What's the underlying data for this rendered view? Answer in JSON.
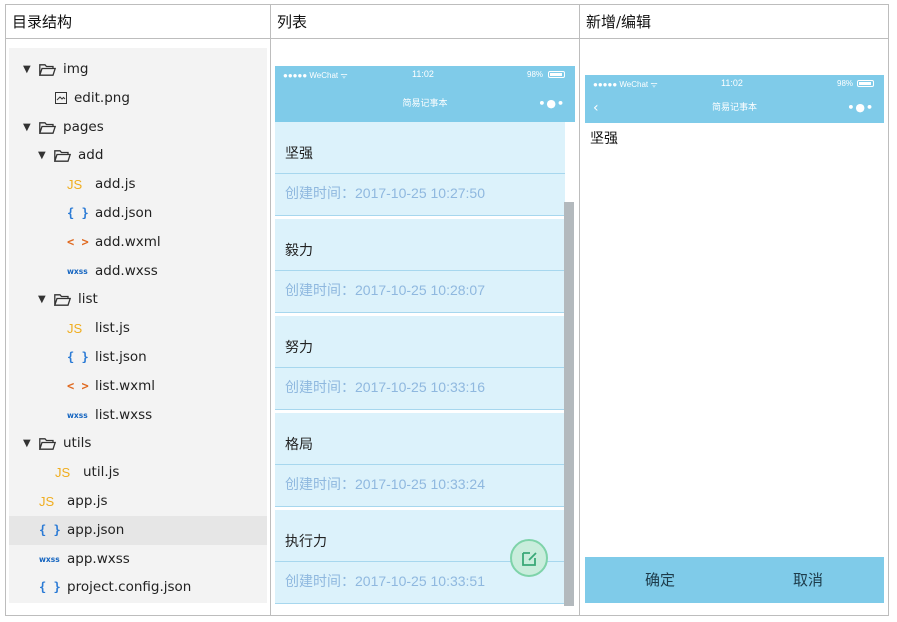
{
  "headers": {
    "col1": "目录结构",
    "col2": "列表",
    "col3": "新增/编辑"
  },
  "colors": {
    "nav": "#7fcbe9",
    "row": "#dcf2fb",
    "time": "#8fb8df",
    "accent_green": "#7ed3a9"
  },
  "tree": [
    {
      "label": "img",
      "type": "folder",
      "icon": "folder-icon"
    },
    {
      "label": "edit.png",
      "type": "image",
      "icon": "image-file-icon"
    },
    {
      "label": "pages",
      "type": "folder",
      "icon": "folder-icon"
    },
    {
      "label": "add",
      "type": "folder",
      "icon": "folder-icon"
    },
    {
      "label": "add.js",
      "type": "js",
      "badge": "JS"
    },
    {
      "label": "add.json",
      "type": "json",
      "badge": "{ }"
    },
    {
      "label": "add.wxml",
      "type": "wxml",
      "badge": "< >"
    },
    {
      "label": "add.wxss",
      "type": "wxss",
      "badge": "wxss"
    },
    {
      "label": "list",
      "type": "folder",
      "icon": "folder-icon"
    },
    {
      "label": "list.js",
      "type": "js",
      "badge": "JS"
    },
    {
      "label": "list.json",
      "type": "json",
      "badge": "{ }"
    },
    {
      "label": "list.wxml",
      "type": "wxml",
      "badge": "< >"
    },
    {
      "label": "list.wxss",
      "type": "wxss",
      "badge": "wxss"
    },
    {
      "label": "utils",
      "type": "folder",
      "icon": "folder-icon"
    },
    {
      "label": "util.js",
      "type": "js",
      "badge": "JS"
    },
    {
      "label": "app.js",
      "type": "js",
      "badge": "JS"
    },
    {
      "label": "app.json",
      "type": "json",
      "badge": "{ }",
      "selected": true
    },
    {
      "label": "app.wxss",
      "type": "wxss",
      "badge": "wxss"
    },
    {
      "label": "project.config.json",
      "type": "json",
      "badge": "{ }"
    }
  ],
  "status_bar": {
    "carrier": "●●●●● WeChat ᯤ",
    "time": "11:02",
    "battery": "98%"
  },
  "list_page": {
    "title": "简易记事本",
    "more": "•●•",
    "items": [
      {
        "title": "坚强",
        "time": "创建时间：2017-10-25 10:27:50"
      },
      {
        "title": "毅力",
        "time": "创建时间：2017-10-25 10:28:07"
      },
      {
        "title": "努力",
        "time": "创建时间：2017-10-25 10:33:16"
      },
      {
        "title": "格局",
        "time": "创建时间：2017-10-25 10:33:24"
      },
      {
        "title": "执行力",
        "time": "创建时间：2017-10-25 10:33:51"
      }
    ]
  },
  "edit_page": {
    "title": "简易记事本",
    "back": "‹",
    "more": "•●•",
    "content": "坚强",
    "confirm": "确定",
    "cancel": "取消"
  }
}
